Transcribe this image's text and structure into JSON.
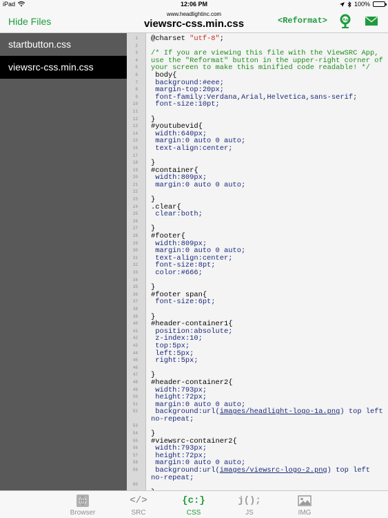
{
  "status_bar": {
    "device": "iPad",
    "time": "12:06 PM",
    "battery": "100%"
  },
  "nav": {
    "left_button": "Hide Files",
    "subtitle": "www.headlightinc.com",
    "title": "viewsrc-css.min.css",
    "reformat_label": "<Reformat>"
  },
  "files": [
    {
      "name": "startbutton.css",
      "selected": false
    },
    {
      "name": "viewsrc-css.min.css",
      "selected": true
    }
  ],
  "code": [
    {
      "n": "1",
      "t": "sel",
      "s": "@charset \"utf-8\";"
    },
    {
      "n": "2",
      "t": "sel",
      "s": ""
    },
    {
      "n": "3",
      "t": "comment",
      "s": "/* If you are viewing this file with the ViewSRC App,"
    },
    {
      "n": "4",
      "t": "comment",
      "s": "use the \"Reformat\" button in the upper-right corner of"
    },
    {
      "n": "5",
      "t": "comment",
      "s": "your screen to make this minified code readable! */"
    },
    {
      "n": "6",
      "t": "sel",
      "s": " body{"
    },
    {
      "n": "7",
      "t": "prop",
      "s": " background:#eee;"
    },
    {
      "n": "8",
      "t": "prop",
      "s": " margin-top:20px;"
    },
    {
      "n": "9",
      "t": "prop",
      "s": " font-family:Verdana,Arial,Helvetica,sans-serif;"
    },
    {
      "n": "10",
      "t": "prop",
      "s": " font-size:10pt;"
    },
    {
      "n": "11",
      "t": "sel",
      "s": ""
    },
    {
      "n": "12",
      "t": "sel",
      "s": "}"
    },
    {
      "n": "13",
      "t": "sel",
      "s": "#youtubevid{"
    },
    {
      "n": "14",
      "t": "prop",
      "s": " width:640px;"
    },
    {
      "n": "15",
      "t": "prop",
      "s": " margin:0 auto 0 auto;"
    },
    {
      "n": "16",
      "t": "prop",
      "s": " text-align:center;"
    },
    {
      "n": "17",
      "t": "sel",
      "s": ""
    },
    {
      "n": "18",
      "t": "sel",
      "s": "}"
    },
    {
      "n": "19",
      "t": "sel",
      "s": "#container{"
    },
    {
      "n": "20",
      "t": "prop",
      "s": " width:809px;"
    },
    {
      "n": "21",
      "t": "prop",
      "s": " margin:0 auto 0 auto;"
    },
    {
      "n": "22",
      "t": "sel",
      "s": ""
    },
    {
      "n": "23",
      "t": "sel",
      "s": "}"
    },
    {
      "n": "24",
      "t": "sel",
      "s": ".clear{"
    },
    {
      "n": "25",
      "t": "prop",
      "s": " clear:both;"
    },
    {
      "n": "26",
      "t": "sel",
      "s": ""
    },
    {
      "n": "27",
      "t": "sel",
      "s": "}"
    },
    {
      "n": "28",
      "t": "sel",
      "s": "#footer{"
    },
    {
      "n": "29",
      "t": "prop",
      "s": " width:809px;"
    },
    {
      "n": "30",
      "t": "prop",
      "s": " margin:0 auto 0 auto;"
    },
    {
      "n": "31",
      "t": "prop",
      "s": " text-align:center;"
    },
    {
      "n": "32",
      "t": "prop",
      "s": " font-size:8pt;"
    },
    {
      "n": "33",
      "t": "prop",
      "s": " color:#666;"
    },
    {
      "n": "34",
      "t": "sel",
      "s": ""
    },
    {
      "n": "35",
      "t": "sel",
      "s": "}"
    },
    {
      "n": "36",
      "t": "sel",
      "s": "#footer span{"
    },
    {
      "n": "37",
      "t": "prop",
      "s": " font-size:6pt;"
    },
    {
      "n": "38",
      "t": "sel",
      "s": ""
    },
    {
      "n": "39",
      "t": "sel",
      "s": "}"
    },
    {
      "n": "40",
      "t": "sel",
      "s": "#header-container1{"
    },
    {
      "n": "41",
      "t": "prop",
      "s": " position:absolute;"
    },
    {
      "n": "42",
      "t": "prop",
      "s": " z-index:10;"
    },
    {
      "n": "43",
      "t": "prop",
      "s": " top:5px;"
    },
    {
      "n": "44",
      "t": "prop",
      "s": " left:5px;"
    },
    {
      "n": "45",
      "t": "prop",
      "s": " right:5px;"
    },
    {
      "n": "46",
      "t": "sel",
      "s": ""
    },
    {
      "n": "47",
      "t": "sel",
      "s": "}"
    },
    {
      "n": "48",
      "t": "sel",
      "s": "#header-container2{"
    },
    {
      "n": "49",
      "t": "prop",
      "s": " width:793px;"
    },
    {
      "n": "50",
      "t": "prop",
      "s": " height:72px;"
    },
    {
      "n": "51",
      "t": "prop",
      "s": " margin:0 auto 0 auto;"
    },
    {
      "n": "52",
      "t": "prop",
      "s": " background:url(images/headlight-logo-1a.png) top left"
    },
    {
      "n": "",
      "t": "cont",
      "s": "no-repeat;"
    },
    {
      "n": "53",
      "t": "sel",
      "s": ""
    },
    {
      "n": "54",
      "t": "sel",
      "s": "}"
    },
    {
      "n": "55",
      "t": "sel",
      "s": "#viewsrc-container2{"
    },
    {
      "n": "56",
      "t": "prop",
      "s": " width:793px;"
    },
    {
      "n": "57",
      "t": "prop",
      "s": " height:72px;"
    },
    {
      "n": "58",
      "t": "prop",
      "s": " margin:0 auto 0 auto;"
    },
    {
      "n": "59",
      "t": "prop",
      "s": " background:url(images/viewsrc-logo-2.png) top left"
    },
    {
      "n": "",
      "t": "cont",
      "s": "no-repeat;"
    },
    {
      "n": "60",
      "t": "sel",
      "s": ""
    },
    {
      "n": "61",
      "t": "sel",
      "s": "}"
    }
  ],
  "tabs": [
    {
      "label": "Browser",
      "icon": "browser-icon",
      "active": false
    },
    {
      "label": "SRC",
      "icon": "src-icon",
      "glyph": "</>",
      "active": false
    },
    {
      "label": "CSS",
      "icon": "css-icon",
      "glyph": "{c:}",
      "active": true
    },
    {
      "label": "JS",
      "icon": "js-icon",
      "glyph": "j();",
      "active": false
    },
    {
      "label": "IMG",
      "icon": "img-icon",
      "active": false
    }
  ],
  "colors": {
    "accent": "#1e9b3c",
    "sidebar": "#595959",
    "selected_file": "#000000",
    "comment": "#1e8e1e",
    "property": "#1a2a7a",
    "string": "#c8281e"
  }
}
